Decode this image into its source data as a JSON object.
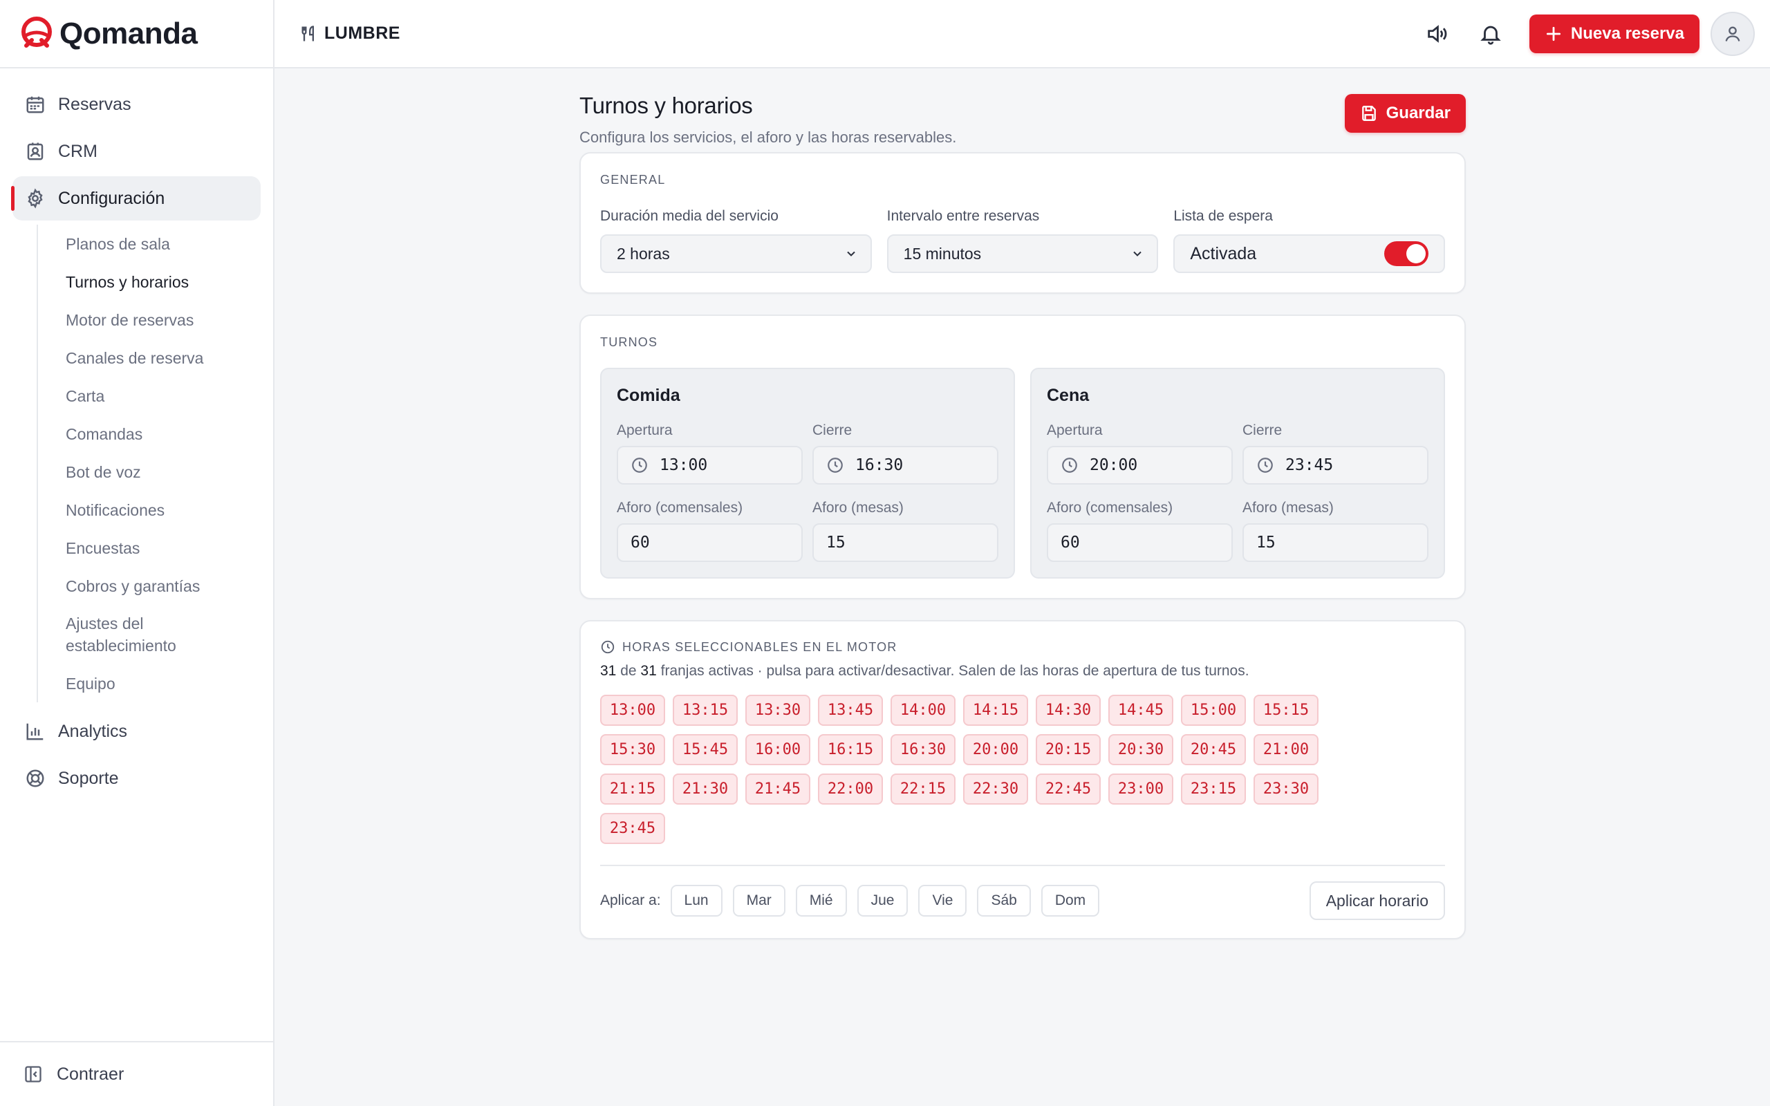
{
  "brand": {
    "name": "Qomanda",
    "accent": "#e11d2a"
  },
  "sidebar": {
    "items": [
      {
        "label": "Reservas",
        "icon": "calendar-icon"
      },
      {
        "label": "CRM",
        "icon": "contact-icon"
      },
      {
        "label": "Configuración",
        "icon": "gear-icon",
        "active": true
      }
    ],
    "subitems": [
      "Planos de sala",
      "Turnos y horarios",
      "Motor de reservas",
      "Canales de reserva",
      "Carta",
      "Comandas",
      "Bot de voz",
      "Notificaciones",
      "Encuestas",
      "Cobros y garantías",
      "Ajustes del establecimiento",
      "Equipo"
    ],
    "bottom_items": [
      {
        "label": "Analytics",
        "icon": "chart-icon"
      },
      {
        "label": "Soporte",
        "icon": "lifebuoy-icon"
      }
    ],
    "collapse_label": "Contraer"
  },
  "header": {
    "venue": "LUMBRE",
    "new_booking": "Nueva reserva"
  },
  "page": {
    "title": "Turnos y horarios",
    "subtitle": "Configura los servicios, el aforo y las horas reservables.",
    "save": "Guardar"
  },
  "general": {
    "section": "GENERAL",
    "duration_label": "Duración media del servicio",
    "duration_value": "2 horas",
    "interval_label": "Intervalo entre reservas",
    "interval_value": "15 minutos",
    "waitlist_label": "Lista de espera",
    "waitlist_value": "Activada",
    "waitlist_on": true
  },
  "turnos": {
    "section": "TURNOS",
    "labels": {
      "open": "Apertura",
      "close": "Cierre",
      "capacity_people": "Aforo (comensales)",
      "capacity_tables": "Aforo (mesas)"
    },
    "items": [
      {
        "name": "Comida",
        "open": "13:00",
        "close": "16:30",
        "people": "60",
        "tables": "15"
      },
      {
        "name": "Cena",
        "open": "20:00",
        "close": "23:45",
        "people": "60",
        "tables": "15"
      }
    ]
  },
  "horas": {
    "section": "HORAS SELECCIONABLES EN EL MOTOR",
    "active": "31",
    "of": "de",
    "total": "31",
    "info_rest": "franjas activas · pulsa para activar/desactivar. Salen de las horas de apertura de tus turnos.",
    "slots": [
      "13:00",
      "13:15",
      "13:30",
      "13:45",
      "14:00",
      "14:15",
      "14:30",
      "14:45",
      "15:00",
      "15:15",
      "15:30",
      "15:45",
      "16:00",
      "16:15",
      "16:30",
      "20:00",
      "20:15",
      "20:30",
      "20:45",
      "21:00",
      "21:15",
      "21:30",
      "21:45",
      "22:00",
      "22:15",
      "22:30",
      "22:45",
      "23:00",
      "23:15",
      "23:30",
      "23:45"
    ],
    "apply_label": "Aplicar a:",
    "days": [
      "Lun",
      "Mar",
      "Mié",
      "Jue",
      "Vie",
      "Sáb",
      "Dom"
    ],
    "apply_button": "Aplicar horario"
  }
}
